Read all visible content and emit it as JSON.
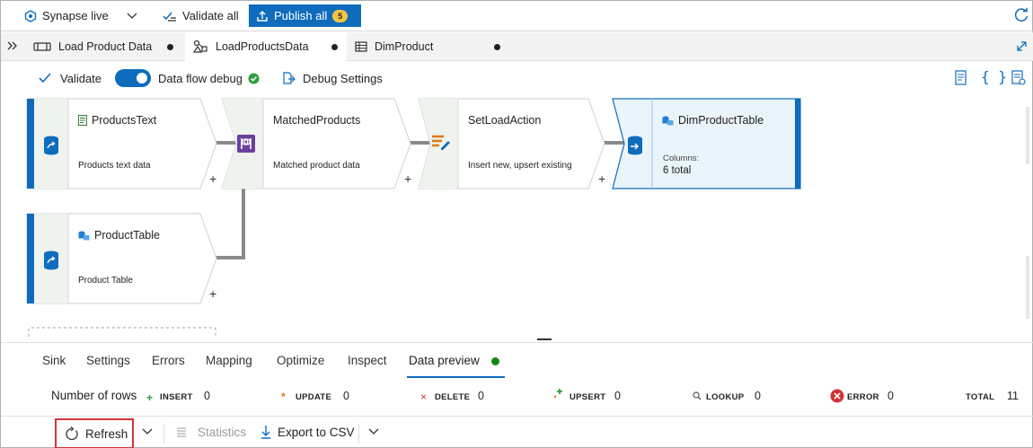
{
  "topbar": {
    "workspace_label": "Synapse live",
    "validate_all_label": "Validate all",
    "publish_label": "Publish all",
    "publish_count": "5"
  },
  "tabs": [
    {
      "label": "Load Product Data"
    },
    {
      "label": "LoadProductsData"
    },
    {
      "label": "DimProduct"
    }
  ],
  "toolbar": {
    "validate_label": "Validate",
    "debug_label": "Data flow debug",
    "debug_settings_label": "Debug Settings"
  },
  "nodes": {
    "products_text": {
      "title": "ProductsText",
      "desc": "Products text data"
    },
    "matched_products": {
      "title": "MatchedProducts",
      "desc": "Matched product data"
    },
    "set_load_action": {
      "title": "SetLoadAction",
      "desc": "Insert new, upsert existing"
    },
    "dim_product_table": {
      "title": "DimProductTable",
      "columns_label": "Columns:",
      "columns_value": "6 total"
    },
    "product_table": {
      "title": "ProductTable",
      "desc": "Product Table"
    }
  },
  "bottom_tabs": [
    "Sink",
    "Settings",
    "Errors",
    "Mapping",
    "Optimize",
    "Inspect",
    "Data preview"
  ],
  "rows": {
    "label": "Number of rows",
    "insert_label": "INSERT",
    "insert_value": "0",
    "update_label": "UPDATE",
    "update_value": "0",
    "delete_label": "DELETE",
    "delete_value": "0",
    "upsert_label": "UPSERT",
    "upsert_value": "0",
    "lookup_label": "LOOKUP",
    "lookup_value": "0",
    "error_label": "ERROR",
    "error_value": "0",
    "total_label": "TOTAL",
    "total_value": "11"
  },
  "actions": {
    "refresh_label": "Refresh",
    "statistics_label": "Statistics",
    "export_label": "Export to CSV"
  },
  "colors": {
    "accent": "#0f6cbd",
    "status_ok": "#2e9d3c",
    "error": "#d13438",
    "highlight_border": "#d13438",
    "sink_fill": "#eaf4fb"
  }
}
